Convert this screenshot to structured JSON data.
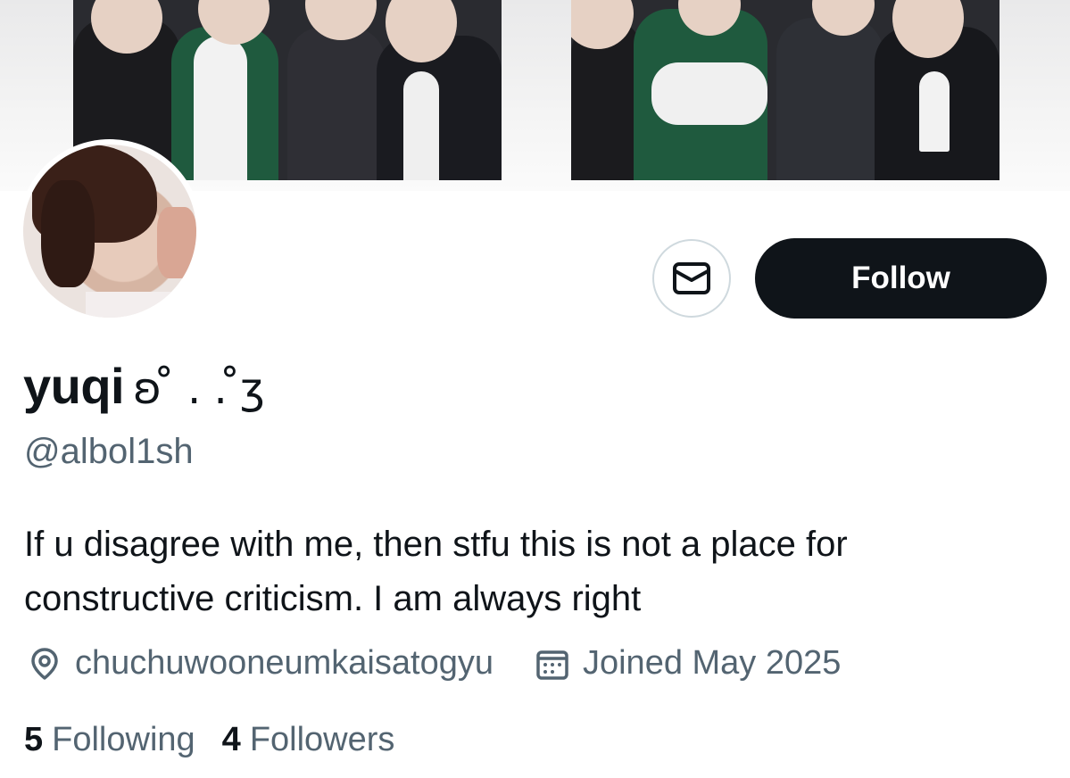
{
  "profile": {
    "display_name": "yuqi",
    "name_kaomoji": "ʚ ̊ . . ̊ʒ",
    "handle": "@albol1sh",
    "bio": "If u disagree with me, then stfu this is not a place for constructive criticism. I am always right",
    "location": "chuchuwooneumkaisatogyu",
    "joined": "Joined May 2025"
  },
  "actions": {
    "follow_label": "Follow",
    "message_icon": "envelope-icon"
  },
  "stats": {
    "following_count": "5",
    "following_label": "Following",
    "followers_count": "4",
    "followers_label": "Followers"
  },
  "icons": {
    "location": "location-pin-icon",
    "joined": "calendar-icon"
  },
  "colors": {
    "text_primary": "#0f1419",
    "text_secondary": "#536471",
    "follow_button_bg": "#0f1419",
    "follow_button_text": "#ffffff",
    "border": "#cfd9de"
  }
}
